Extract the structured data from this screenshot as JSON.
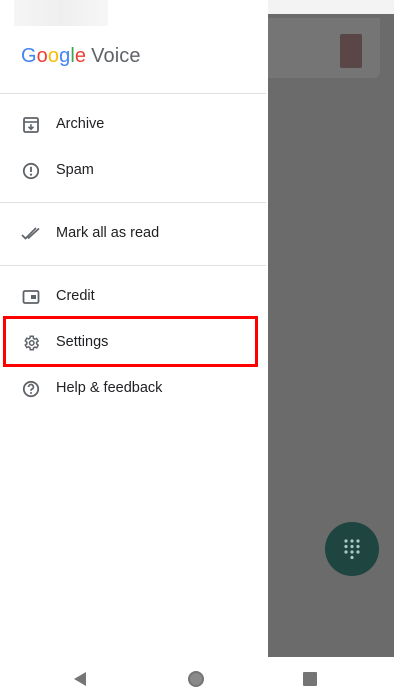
{
  "app": {
    "brand_google": [
      "G",
      "o",
      "o",
      "g",
      "l",
      "e"
    ],
    "brand_google_colors": [
      "#4285F4",
      "#EA4335",
      "#FBBC05",
      "#4285F4",
      "#34A853",
      "#EA4335"
    ],
    "brand_voice": "Voice"
  },
  "drawer": {
    "items": [
      {
        "label": "Archive",
        "icon": "archive-icon"
      },
      {
        "label": "Spam",
        "icon": "spam-icon"
      },
      {
        "label": "Mark all as read",
        "icon": "mark-read-icon"
      },
      {
        "label": "Credit",
        "icon": "credit-icon"
      },
      {
        "label": "Settings",
        "icon": "gear-icon",
        "highlighted": true
      },
      {
        "label": "Help & feedback",
        "icon": "help-icon"
      }
    ]
  },
  "colors": {
    "highlight": "#ff0000",
    "fab": "#1f4540",
    "scrim": "#6b6b6b",
    "icon": "#5f6368"
  },
  "system_nav": {
    "icons": [
      "back-icon",
      "home-icon",
      "recents-icon"
    ]
  }
}
